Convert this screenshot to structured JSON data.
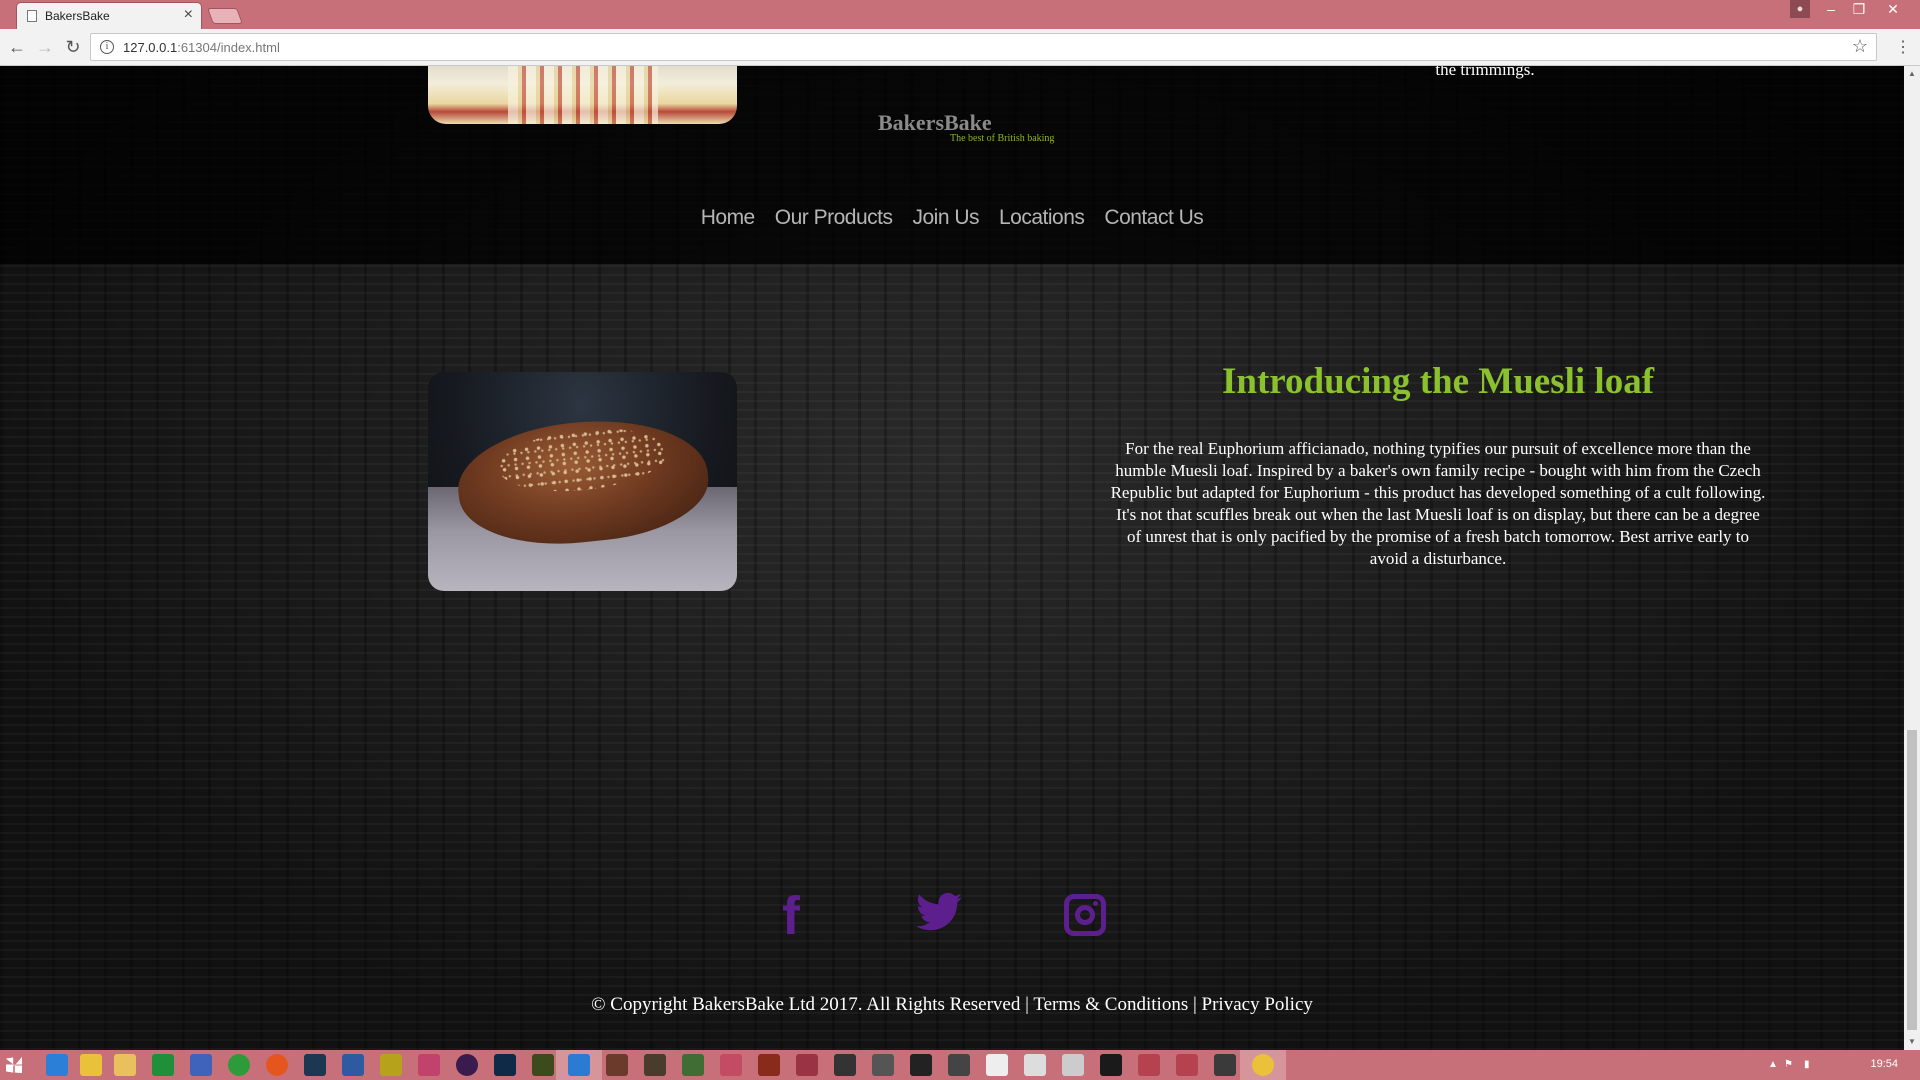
{
  "browser": {
    "tab_title": "BakersBake",
    "url_host": "127.0.0.1",
    "url_rest": ":61304/index.html",
    "profile_icon": "person-icon"
  },
  "site": {
    "logo": "BakersBake",
    "tagline": "The best of British baking",
    "trim_text": "the trimmings.",
    "nav": [
      "Home",
      "Our Products",
      "Join Us",
      "Locations",
      "Contact Us"
    ],
    "feature": {
      "title": "Introducing the Muesli loaf",
      "body": "For the real Euphorium afficianado, nothing typifies our pursuit of excellence more than the humble Muesli loaf. Inspired by a baker's own family recipe - bought with him from the Czech Republic but adapted for Euphorium - this product has developed something of a cult following. It's not that scuffles break out when the last Muesli loaf is on display, but there can be a degree of unrest that is only pacified by the promise of a fresh batch tomorrow. Best arrive early to avoid a disturbance."
    },
    "social": {
      "facebook_glyph": "f",
      "icons": [
        "facebook-icon",
        "twitter-icon",
        "instagram-icon"
      ],
      "color": "#5d1f8e"
    },
    "footer": {
      "copyright": "© Copyright BakersBake Ltd 2017. All Rights Reserved",
      "separator": " | ",
      "terms": "Terms & Conditions",
      "privacy": "Privacy Policy"
    },
    "colors": {
      "accent_green": "#8cc12e",
      "nav_text": "#b5b5b5"
    }
  },
  "taskbar": {
    "clock": "19:54"
  }
}
